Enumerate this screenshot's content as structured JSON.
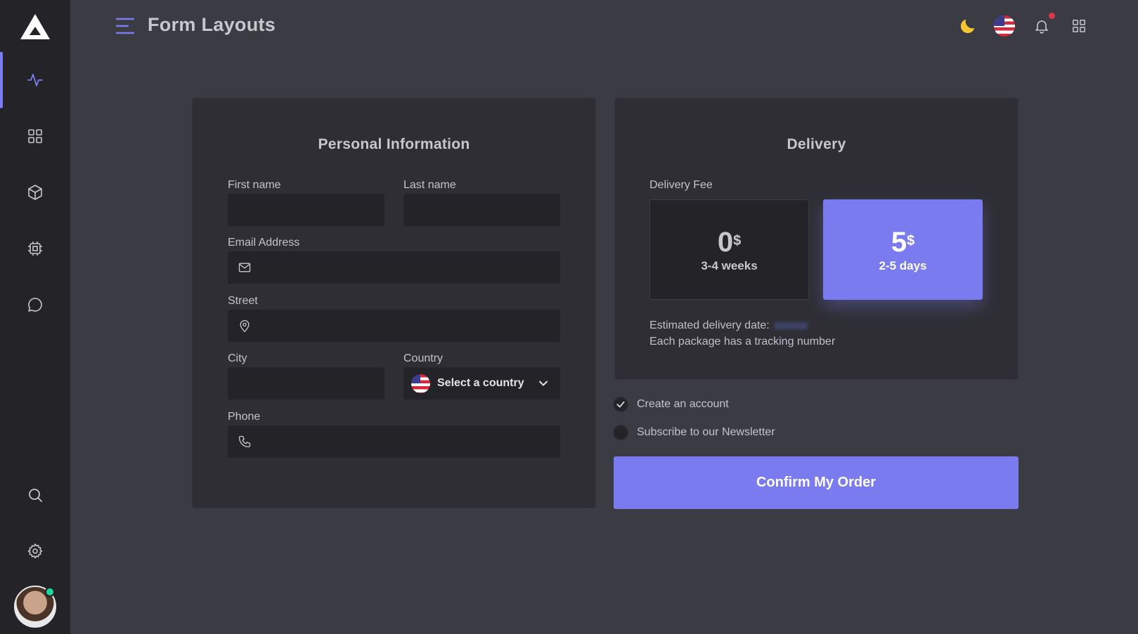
{
  "header": {
    "title": "Form Layouts"
  },
  "colors": {
    "accent": "#7b7bf0",
    "background": "#3b3b43",
    "sidebar": "#232328",
    "card": "#2e2e34",
    "online": "#1fd8a0",
    "notification": "#e0344a",
    "moon": "#f7c531"
  },
  "sidebar": {
    "items": [
      {
        "icon": "activity-icon",
        "active": true
      },
      {
        "icon": "grid-icon",
        "active": false
      },
      {
        "icon": "box-icon",
        "active": false
      },
      {
        "icon": "cpu-icon",
        "active": false
      },
      {
        "icon": "chat-icon",
        "active": false
      },
      {
        "icon": "search-icon",
        "active": false
      },
      {
        "icon": "settings-icon",
        "active": false
      }
    ]
  },
  "personal": {
    "title": "Personal Information",
    "first_name_label": "First name",
    "last_name_label": "Last name",
    "email_label": "Email Address",
    "street_label": "Street",
    "city_label": "City",
    "country_label": "Country",
    "country_value": "Select a country",
    "phone_label": "Phone"
  },
  "delivery": {
    "title": "Delivery",
    "fee_label": "Delivery Fee",
    "options": [
      {
        "price": "0",
        "currency": "$",
        "duration": "3-4 weeks",
        "selected": false
      },
      {
        "price": "5",
        "currency": "$",
        "duration": "2-5 days",
        "selected": true
      }
    ],
    "estimated_label": "Estimated delivery date:",
    "tracking_note": "Each package has a tracking number"
  },
  "options": {
    "create_account": {
      "label": "Create an account",
      "checked": true
    },
    "newsletter": {
      "label": "Subscribe to our Newsletter",
      "checked": false
    }
  },
  "confirm_label": "Confirm My Order"
}
